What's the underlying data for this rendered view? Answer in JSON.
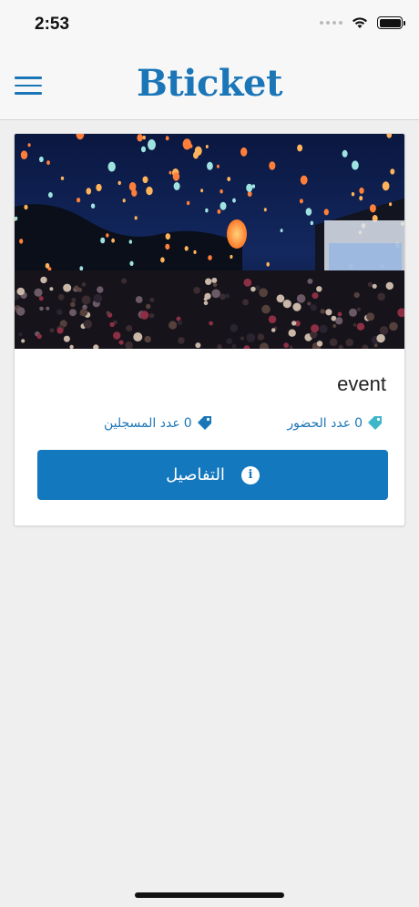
{
  "status": {
    "time": "2:53"
  },
  "header": {
    "brand": "Bticket"
  },
  "event": {
    "title": "event",
    "attendance": {
      "count": "0",
      "label": "عدد الحضور"
    },
    "registered": {
      "count": "0",
      "label": "عدد المسجلين"
    },
    "details_label": "التفاصيل"
  },
  "colors": {
    "brand": "#1b76b8",
    "button": "#1478be",
    "tag_attendance": "#3fb6c9",
    "tag_registered": "#1b76b8"
  },
  "icons": {
    "menu": "hamburger-icon",
    "attendance": "tag-icon",
    "registered": "tag-icon",
    "details": "info-icon"
  }
}
